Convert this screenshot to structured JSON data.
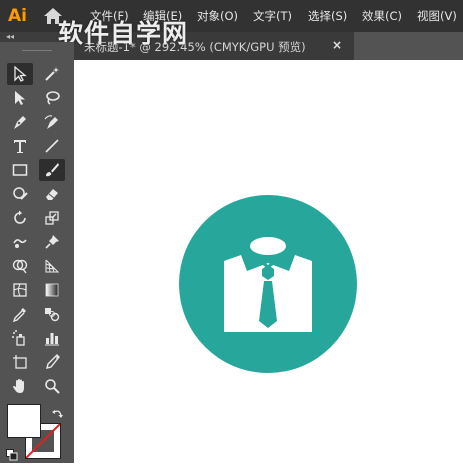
{
  "app": {
    "logo_text": "Ai",
    "accent_color": "#ff9a00",
    "watermark_text": "软件自学网"
  },
  "menu": {
    "items": [
      {
        "label": "文件(F)"
      },
      {
        "label": "编辑(E)"
      },
      {
        "label": "对象(O)"
      },
      {
        "label": "文字(T)"
      },
      {
        "label": "选择(S)"
      },
      {
        "label": "效果(C)"
      },
      {
        "label": "视图(V)"
      }
    ]
  },
  "document_tab": {
    "title": "未标题-1* @ 292.45% (CMYK/GPU 预览)",
    "close_label": "×"
  },
  "toolbar": {
    "collapse_label": "◂◂",
    "tools": [
      {
        "name": "selection-tool",
        "icon": "arrow-outline-icon"
      },
      {
        "name": "magic-wand-tool",
        "icon": "magic-wand-icon"
      },
      {
        "name": "direct-selection-tool",
        "icon": "arrow-solid-icon"
      },
      {
        "name": "lasso-tool",
        "icon": "lasso-icon"
      },
      {
        "name": "pen-tool",
        "icon": "pen-icon"
      },
      {
        "name": "curvature-tool",
        "icon": "curvature-pen-icon"
      },
      {
        "name": "type-tool",
        "icon": "type-icon"
      },
      {
        "name": "line-segment-tool",
        "icon": "line-icon"
      },
      {
        "name": "rectangle-tool",
        "icon": "rectangle-icon"
      },
      {
        "name": "paintbrush-tool",
        "icon": "brush-icon"
      },
      {
        "name": "shaper-tool",
        "icon": "shaper-icon"
      },
      {
        "name": "eraser-tool",
        "icon": "eraser-icon"
      },
      {
        "name": "rotate-tool",
        "icon": "rotate-icon"
      },
      {
        "name": "scale-tool",
        "icon": "scale-icon"
      },
      {
        "name": "puppet-warp-tool",
        "icon": "warp-icon"
      },
      {
        "name": "pin-tool",
        "icon": "pin-icon"
      },
      {
        "name": "shape-builder-tool",
        "icon": "shape-builder-icon"
      },
      {
        "name": "perspective-grid-tool",
        "icon": "perspective-grid-icon"
      },
      {
        "name": "mesh-tool",
        "icon": "mesh-icon"
      },
      {
        "name": "gradient-tool",
        "icon": "gradient-icon"
      },
      {
        "name": "eyedropper-tool",
        "icon": "eyedropper-icon"
      },
      {
        "name": "blend-tool",
        "icon": "blend-icon"
      },
      {
        "name": "symbol-sprayer-tool",
        "icon": "symbol-sprayer-icon"
      },
      {
        "name": "column-graph-tool",
        "icon": "column-graph-icon"
      },
      {
        "name": "artboard-tool",
        "icon": "artboard-icon"
      },
      {
        "name": "slice-tool",
        "icon": "slice-icon"
      },
      {
        "name": "hand-tool",
        "icon": "hand-icon"
      },
      {
        "name": "zoom-tool",
        "icon": "zoom-icon"
      }
    ],
    "active_tools": [
      "selection-tool",
      "paintbrush-tool"
    ],
    "fill_color": "#ffffff",
    "stroke_color": "none"
  },
  "canvas": {
    "background_color": "#ffffff",
    "artwork": {
      "icon": "shirt-tie-icon",
      "circle_color": "#27a79b",
      "shape_color": "#ffffff"
    }
  }
}
